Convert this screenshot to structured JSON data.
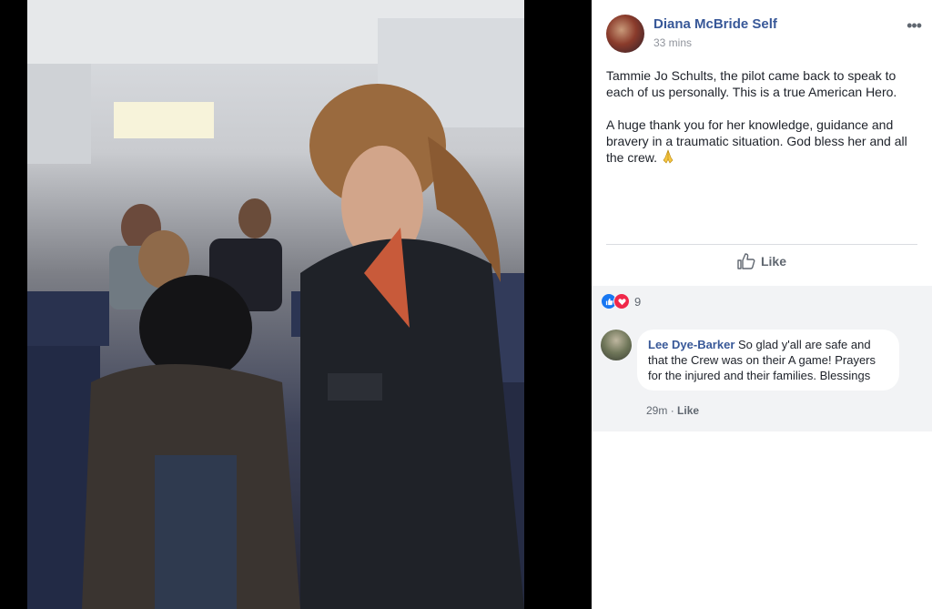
{
  "post": {
    "author": "Diana McBride Self",
    "timestamp": "33 mins",
    "more": "•••",
    "paragraph1": "Tammie Jo Schults, the pilot came back to speak to each of us personally. This is a true American Hero.",
    "paragraph2": "A huge thank you for her knowledge, guidance and bravery in a traumatic situation. God bless her and all the crew.",
    "emoji": "praying-hands"
  },
  "actions": {
    "like_label": "Like"
  },
  "reactions": {
    "count": "9",
    "types": [
      "like",
      "love"
    ]
  },
  "comment": {
    "author": "Lee Dye-Barker",
    "text": "So glad y'all are safe and that the Crew was on their A game! Prayers for the injured and their families. Blessings",
    "time": "29m",
    "separator": "·",
    "like_label": "Like"
  },
  "photo": {
    "icon": "photo",
    "description_hidden": true
  },
  "colors": {
    "link": "#385898",
    "like_blue": "#1877f2",
    "love_red": "#f0284a",
    "comment_bg": "#f2f3f5"
  }
}
